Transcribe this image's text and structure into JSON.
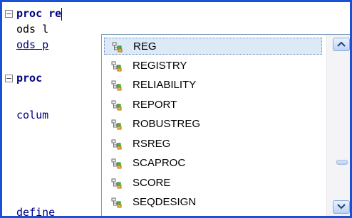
{
  "editor": {
    "line1": {
      "keyword": "proc",
      "typed": "re"
    },
    "line2": {
      "text": "ods l"
    },
    "line3": {
      "text": "ods p"
    },
    "line5": {
      "keyword": "proc"
    },
    "line7": {
      "text": "colum"
    },
    "line11": {
      "text": "define"
    }
  },
  "autocomplete": {
    "selected_index": 0,
    "item_icon": "procedure-icon",
    "items": [
      {
        "label": "REG"
      },
      {
        "label": "REGISTRY"
      },
      {
        "label": "RELIABILITY"
      },
      {
        "label": "REPORT"
      },
      {
        "label": "ROBUSTREG"
      },
      {
        "label": "RSREG"
      },
      {
        "label": "SCAPROC"
      },
      {
        "label": "SCORE"
      },
      {
        "label": "SEQDESIGN"
      }
    ],
    "scroll_position": 0.8
  },
  "colors": {
    "frame_border": "#1a4fd8",
    "keyword": "#000080",
    "selection": "#dceaf7"
  }
}
